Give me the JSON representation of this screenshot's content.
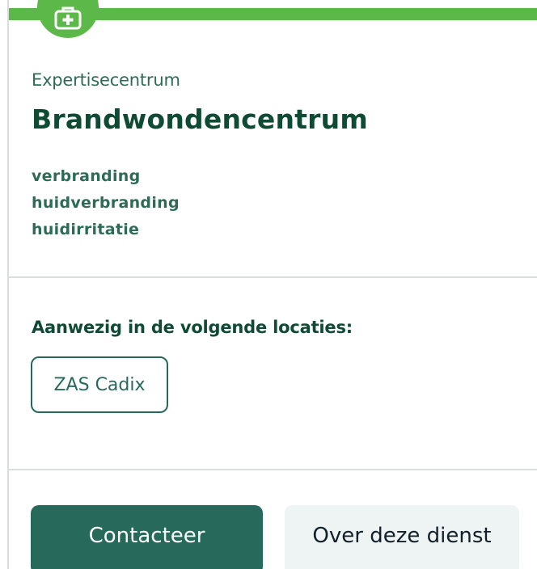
{
  "card": {
    "subtitle": "Expertisecentrum",
    "title": "Brandwondencentrum",
    "tags": [
      "verbranding",
      "huidverbranding",
      "huidirritatie"
    ],
    "icon": "first-aid-kit-icon"
  },
  "locations": {
    "heading": "Aanwezig in de volgende locaties:",
    "items": [
      "ZAS Cadix"
    ]
  },
  "actions": {
    "contact_label": "Contacteer",
    "about_label": "Over deze dienst"
  },
  "colors": {
    "accent_green": "#5cb848",
    "primary_teal": "#27695a",
    "heading_dark_green": "#0f4a35",
    "secondary_bg": "#eef3f4"
  }
}
